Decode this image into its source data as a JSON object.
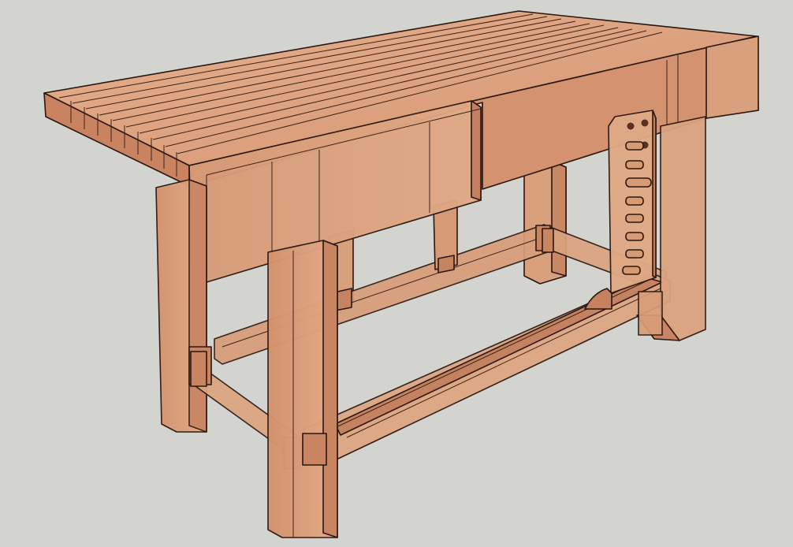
{
  "scene": {
    "background": "#d3d4d0",
    "material": {
      "wood_light": "#e2aa86",
      "wood_mid": "#d39370",
      "wood_dark": "#b9704f",
      "wood_shadow": "#a4613f",
      "edge": "#2a170f",
      "peg": "#d69b72",
      "peg_hole": "#5a3120"
    },
    "objects": [
      "laminated-benchtop",
      "front-apron-board",
      "legs",
      "stretchers",
      "sliding-deadman",
      "bottom-rail"
    ]
  }
}
